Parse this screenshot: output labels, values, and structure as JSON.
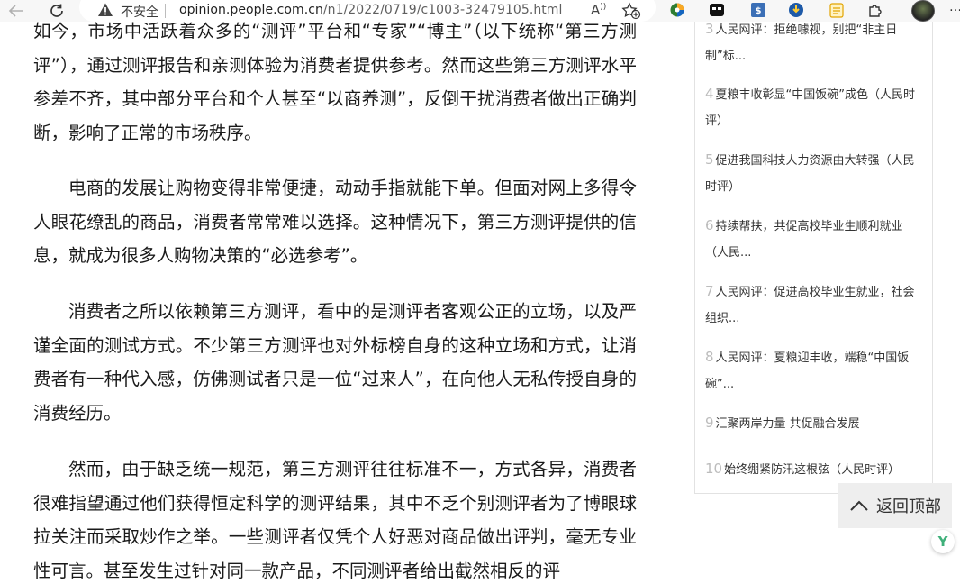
{
  "browser": {
    "security_label": "不安全",
    "url_host": "opinion.people.com.cn",
    "url_path": "/n1/2022/0719/c1003-32479105.html",
    "read_aloud_label": "A",
    "extensions": [
      "color-ext-icon",
      "game-ext-icon",
      "translate-ext-icon",
      "download-ext-icon",
      "notes-ext-icon",
      "puzzle-icon"
    ]
  },
  "article": {
    "paragraphs": [
      "如今，市场中活跃着众多的“测评”平台和“专家”“博主”（以下统称“第三方测评”），通过测评报告和亲测体验为消费者提供参考。然而这些第三方测评水平参差不齐，其中部分平台和个人甚至“以商养测”，反倒干扰消费者做出正确判断，影响了正常的市场秩序。",
      "电商的发展让购物变得非常便捷，动动手指就能下单。但面对网上多得令人眼花缭乱的商品，消费者常常难以选择。这种情况下，第三方测评提供的信息，就成为很多人购物决策的“必选参考”。",
      "消费者之所以依赖第三方测评，看中的是测评者客观公正的立场，以及严谨全面的测试方式。不少第三方测评也对外标榜自身的这种立场和方式，让消费者有一种代入感，仿佛测试者只是一位“过来人”，在向他人无私传授自身的消费经历。",
      "然而，由于缺乏统一规范，第三方测评往往标准不一，方式各异，消费者很难指望通过他们获得恒定科学的测评结果，其中不乏个别测评者为了博眼球拉关注而采取炒作之举。一些测评者仅凭个人好恶对商品做出评判，毫无专业性可言。甚至发生过针对同一款产品，不同测评者给出截然相反的评"
    ]
  },
  "sidebar": {
    "items": [
      {
        "num": "3",
        "title": "人民网评：拒绝噱视，别把“非主日制”标..."
      },
      {
        "num": "4",
        "title": "夏粮丰收彰显“中国饭碗”成色（人民时评）"
      },
      {
        "num": "5",
        "title": "促进我国科技人力资源由大转强（人民时评）"
      },
      {
        "num": "6",
        "title": "持续帮扶，共促高校毕业生顺利就业（人民..."
      },
      {
        "num": "7",
        "title": "人民网评：促进高校毕业生就业，社会组织..."
      },
      {
        "num": "8",
        "title": "人民网评：夏粮迎丰收，端稳“中国饭碗”..."
      },
      {
        "num": "9",
        "title": "汇聚两岸力量 共促融合发展"
      },
      {
        "num": "10",
        "title": "始终绷紧防汛这根弦（人民时评）"
      }
    ]
  },
  "back_to_top": {
    "label": "返回顶部"
  },
  "badge": {
    "label": "Y"
  }
}
